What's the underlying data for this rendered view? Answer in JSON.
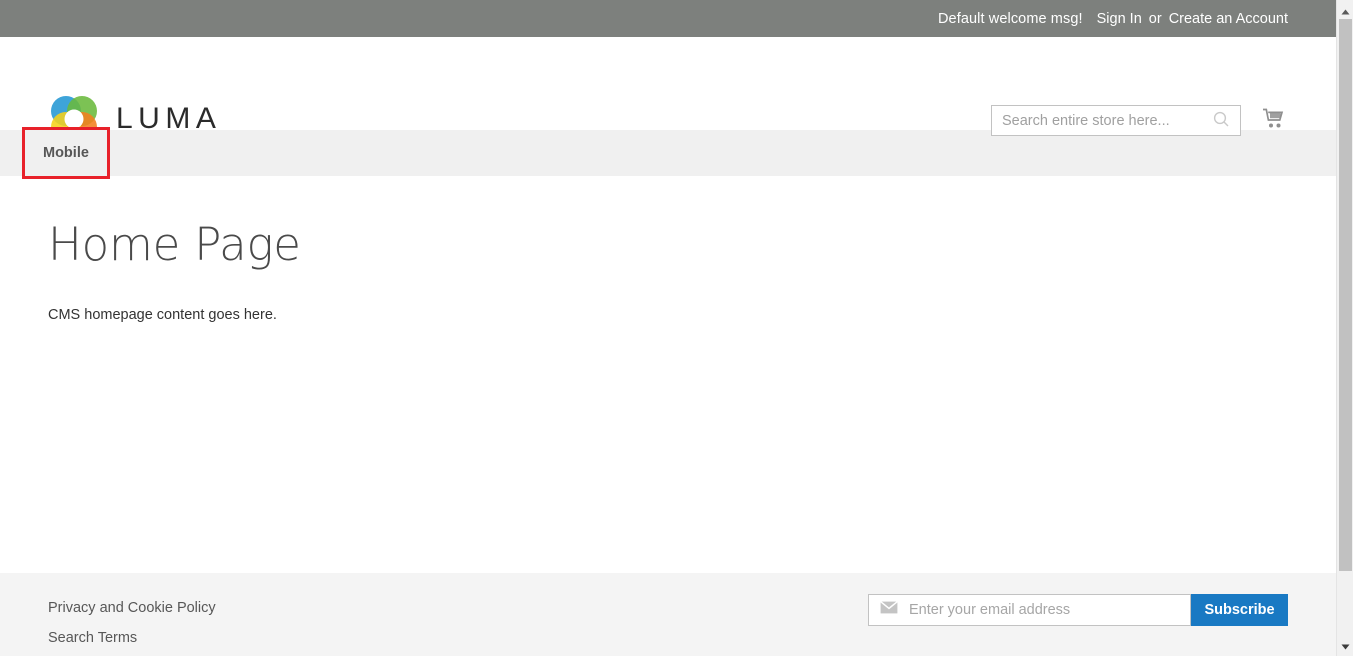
{
  "top_panel": {
    "welcome_message": "Default welcome msg!",
    "sign_in_label": "Sign In",
    "separator": "or",
    "create_account_label": "Create an Account",
    "background_color": "#7d807d"
  },
  "header": {
    "logo_text": "LUMA",
    "logo_icon": "luma-flower-logo",
    "search": {
      "placeholder": "Search entire store here...",
      "value": "",
      "icon": "search-icon"
    },
    "cart": {
      "icon": "shopping-cart-icon"
    }
  },
  "nav": {
    "items": [
      {
        "label": "Mobile",
        "highlighted": true
      }
    ],
    "highlight_color": "#e8212a",
    "background_color": "#f0f0f0"
  },
  "main": {
    "page_title": "Home Page",
    "cms_content": "CMS homepage content goes here."
  },
  "footer": {
    "links": [
      {
        "label": "Privacy and Cookie Policy"
      },
      {
        "label": "Search Terms"
      }
    ],
    "newsletter": {
      "icon": "envelope-icon",
      "placeholder": "Enter your email address",
      "value": "",
      "subscribe_label": "Subscribe",
      "button_color": "#1979c3"
    },
    "background_color": "#f4f4f4"
  },
  "scrollbar": {
    "up_arrow_icon": "chevron-up-icon",
    "down_arrow_icon": "chevron-down-icon",
    "thumb_color": "#c1c1c1"
  }
}
